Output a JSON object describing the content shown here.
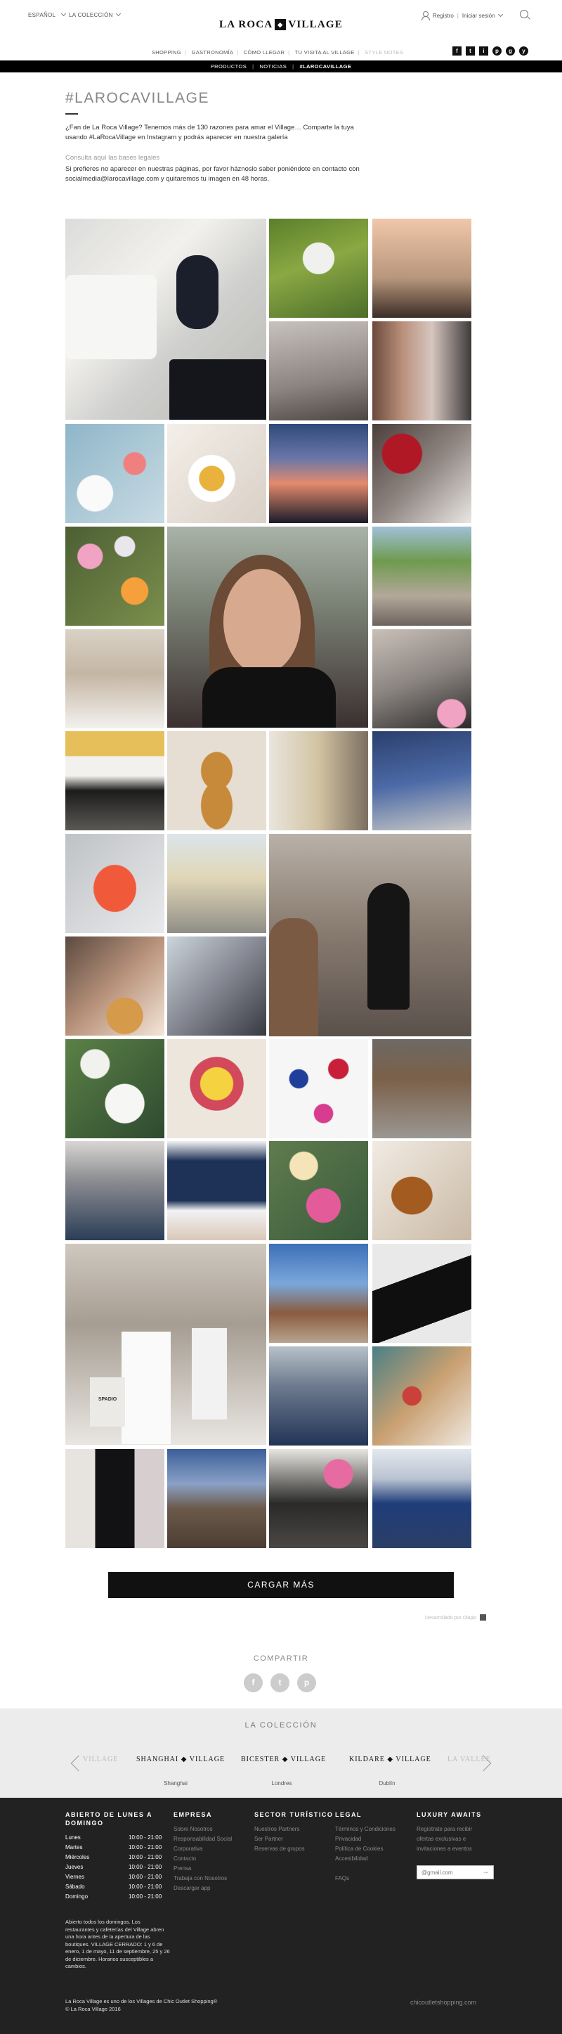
{
  "header": {
    "language": "ESPAÑOL",
    "collection": "LA COLECCIÓN",
    "logo_left": "LA ROCA",
    "logo_right": "VILLAGE",
    "register": "Registro",
    "login": "Iniciar sesión",
    "nav": [
      "SHOPPING",
      "GASTRONOMÍA",
      "CÓMO LLEGAR",
      "TU VISITA AL VILLAGE",
      "STYLE NOTES"
    ],
    "social": [
      "f",
      "t",
      "i",
      "p",
      "g",
      "y"
    ]
  },
  "subnav": {
    "items": [
      "PRODUCTOS",
      "NOTICIAS"
    ],
    "current": "#LAROCAVILLAGE"
  },
  "intro": {
    "title": "#LAROCAVILLAGE",
    "text": "¿Fan de La Roca Village? Tenemos más de 130 razones para amar el Village… Comparte la tuya usando #LaRocaVillage en Instagram y podrás aparecer en nuestra galería",
    "legal_link": "Consulta aquí las bases legales",
    "text2": "Si prefieres no aparecer en nuestras páginas, por favor háznoslo saber poniéndote en contacto con socialmedia@larocavillage.com y quitaremos tu imagen en 48 horas."
  },
  "gallery": {
    "photo_count": 40,
    "spadio_text": "SPADIO"
  },
  "load_more": "CARGAR MÁS",
  "powered_by": "Desarrollado por Olapic",
  "share": {
    "title": "COMPARTIR",
    "icons": [
      "f",
      "t",
      "p"
    ]
  },
  "collection_band": {
    "title": "LA COLECCIÓN",
    "villages": [
      {
        "name": "VILLAGE",
        "city": ""
      },
      {
        "name": "SHANGHAI",
        "suffix": "VILLAGE",
        "city": "Shanghai"
      },
      {
        "name": "BICESTER",
        "suffix": "VILLAGE",
        "city": "Londres"
      },
      {
        "name": "KILDARE",
        "suffix": "VILLAGE",
        "city": "Dublín"
      },
      {
        "name": "LA VALLÉE",
        "city": ""
      }
    ]
  },
  "footer": {
    "hours_title": "ABIERTO DE LUNES A DOMINGO",
    "hours": [
      {
        "day": "Lunes",
        "time": "10:00 - 21:00"
      },
      {
        "day": "Martes",
        "time": "10:00 - 21:00"
      },
      {
        "day": "Miércoles",
        "time": "10:00 - 21:00"
      },
      {
        "day": "Jueves",
        "time": "10:00 - 21:00"
      },
      {
        "day": "Viernes",
        "time": "10:00 - 21:00"
      },
      {
        "day": "Sábado",
        "time": "10:00 - 21:00"
      },
      {
        "day": "Domingo",
        "time": "10:00 - 21:00"
      }
    ],
    "hours_note": "Abierto todos los domingos. Los restaurantes y cafeterías del Village abren una hora antes de la apertura de las boutiques. VILLAGE CERRADO: 1 y 6 de enero, 1 de mayo, 11 de septiembre, 25 y 26 de diciembre. Horarios susceptibles a cambios.",
    "empresa_title": "EMPRESA",
    "empresa_links": [
      "Sobre Nosotros",
      "Responsabilidad Social Corporativa",
      "Contacto",
      "Prensa",
      "Trabaja con Nosotros",
      "Descargar app"
    ],
    "sector_title": "SECTOR TURÍSTICO",
    "sector_links": [
      "Nuestros Partners",
      "Ser Partner",
      "Reservas de grupos"
    ],
    "legal_title": "LEGAL",
    "legal_links": [
      "Términos y Condiciones",
      "Privacidad",
      "Política de Cookies",
      "Accesibilidad",
      "FAQs"
    ],
    "luxury_title": "LUXURY AWAITS",
    "luxury_text": "Regístrate para recibir ofertas exclusivas e invitaciones a eventos",
    "email_placeholder": "@gmail.com",
    "bottom_line1": "La Roca Village es uno de los Villages de Chic Outlet Shopping®",
    "bottom_line2": "© La Roca Village 2016",
    "chic_link": "chicoutletshopping.com"
  }
}
